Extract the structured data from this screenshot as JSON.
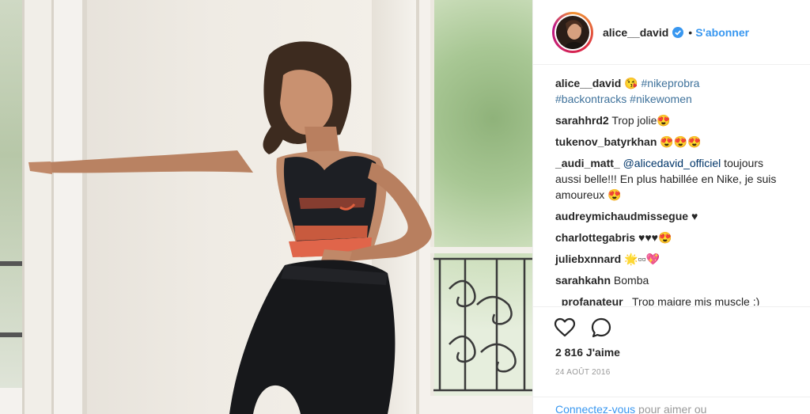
{
  "header": {
    "username": "alice__david",
    "dot": "•",
    "follow_label": "S'abonner"
  },
  "caption": {
    "author": "alice__david",
    "emoji": "😘",
    "tags": [
      "#nikeprobra",
      "#backontracks",
      "#nikewomen"
    ]
  },
  "comments": [
    {
      "author": "sarahhrd2",
      "text": " Trop jolie😍"
    },
    {
      "author": "tukenov_batyrkhan",
      "text": " 😍😍😍"
    },
    {
      "author": "_audi_matt_",
      "mention": "@alicedavid_officiel",
      "text": " toujours aussi belle!!! En plus habillée en Nike, je suis amoureux 😍"
    },
    {
      "author": "audreymichaudmissegue",
      "text": " ♥"
    },
    {
      "author": "charlottegabris",
      "text": " ♥♥♥😍"
    },
    {
      "author": "juliebxnnard",
      "text": " 🌟▫▫💖"
    },
    {
      "author": "sarahkahn",
      "text": " Bomba"
    },
    {
      "author": "_profanateur_",
      "text": " Trop maigre mis muscle ;)"
    }
  ],
  "actions": {
    "likes": "2 816 J'aime",
    "date": "24 AOÛT 2016"
  },
  "login": {
    "link": "Connectez-vous",
    "rest": " pour aimer ou"
  },
  "colors": {
    "accent": "#3897f0",
    "tag": "#003569"
  }
}
